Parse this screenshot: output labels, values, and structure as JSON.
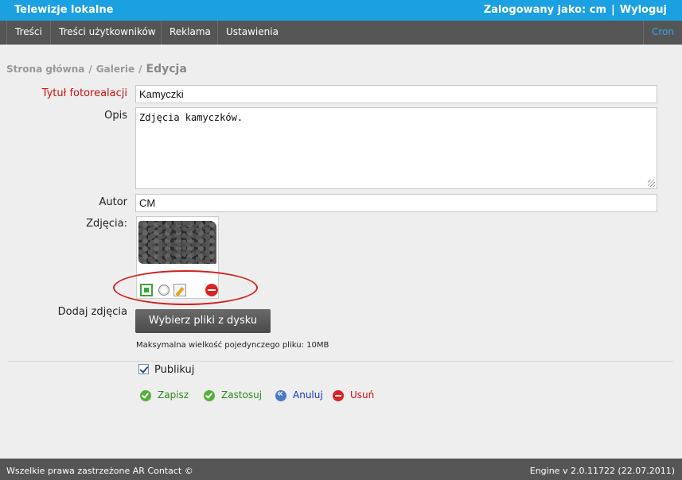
{
  "header": {
    "app_title": "Telewizje lokalne",
    "logged_in_as": "Zalogowany jako: cm",
    "separator": "|",
    "logout": "Wyloguj"
  },
  "nav": {
    "items": [
      "Treści",
      "Treści użytkowników",
      "Reklama",
      "Ustawienia"
    ],
    "cron": "Cron"
  },
  "breadcrumb": {
    "items": [
      "Strona główna",
      "Galerie"
    ],
    "separator": "/",
    "current": "Edycja"
  },
  "form": {
    "title_label": "Tytuł fotorealacji",
    "title_value": "Kamyczki",
    "description_label": "Opis",
    "description_value": "Zdjęcia kamyczków.",
    "author_label": "Autor",
    "author_value": "CM",
    "photos_label": "Zdjęcia:",
    "add_photos_label": "Dodaj zdjęcia",
    "choose_files_button": "Wybierz pliki z dysku",
    "max_size_note": "Maksymalna wielkość pojedynczego pliku: 10MB",
    "publish_label": "Publikuj",
    "publish_checked": true
  },
  "photo_actions": {
    "icons": [
      "expand-icon",
      "radio-icon",
      "edit-icon",
      "delete-icon"
    ]
  },
  "actions": {
    "save": "Zapisz",
    "apply": "Zastosuj",
    "cancel": "Anuluj",
    "delete": "Usuń"
  },
  "footer": {
    "copyright": "Wszelkie prawa zastrzeżone AR Contact ©",
    "version": "Engine v 2.0.11722 (22.07.2011)"
  },
  "colors": {
    "topbar": "#1ba0e1",
    "navbar": "#555555",
    "required_label": "#cc1111",
    "highlight_ellipse": "#d42020"
  }
}
